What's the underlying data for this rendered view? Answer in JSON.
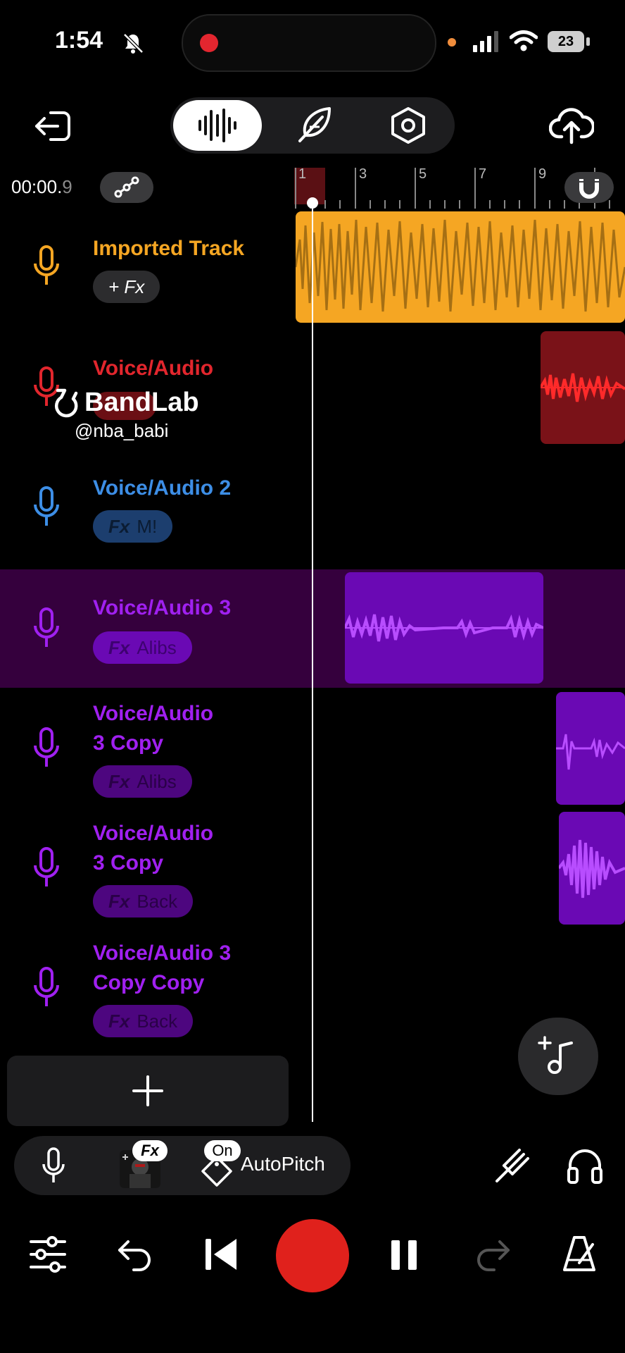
{
  "status_bar": {
    "time": "1:54",
    "battery": "23"
  },
  "transport_time": {
    "main": "00:00.",
    "decimal": "9"
  },
  "ruler": {
    "marks": [
      "1",
      "3",
      "5",
      "7",
      "9"
    ]
  },
  "tracks": [
    {
      "name": "Imported Track",
      "fx_label": "+ Fx",
      "preset": "",
      "color": "#f5a623"
    },
    {
      "name": "Voice/Audio",
      "fx_label": "",
      "preset": "",
      "color": "#e2262d"
    },
    {
      "name": "Voice/Audio 2",
      "fx_label": "Fx",
      "preset": "M!",
      "color": "#3d8ee6"
    },
    {
      "name": "Voice/Audio 3",
      "fx_label": "Fx",
      "preset": "Alibs",
      "color": "#a020f0"
    },
    {
      "name_line1": "Voice/Audio",
      "name_line2": "3 Copy",
      "fx_label": "Fx",
      "preset": "Alibs",
      "color": "#a020f0"
    },
    {
      "name_line1": "Voice/Audio",
      "name_line2": "3 Copy",
      "fx_label": "Fx",
      "preset": "Back",
      "color": "#a020f0"
    },
    {
      "name_line1": "Voice/Audio 3",
      "name_line2": "Copy Copy",
      "fx_label": "Fx",
      "preset": "Back",
      "color": "#a020f0"
    }
  ],
  "watermark": {
    "brand": "BandLab",
    "handle": "@nba_babi"
  },
  "bottom_toolbar": {
    "fx_badge": "Fx",
    "on_badge": "On",
    "autopitch": "AutoPitch"
  },
  "colors": {
    "accent_record": "#e0211c",
    "imported": "#f5a623",
    "voice": "#e2262d",
    "voice2": "#3d8ee6",
    "voice3": "#a020f0"
  }
}
